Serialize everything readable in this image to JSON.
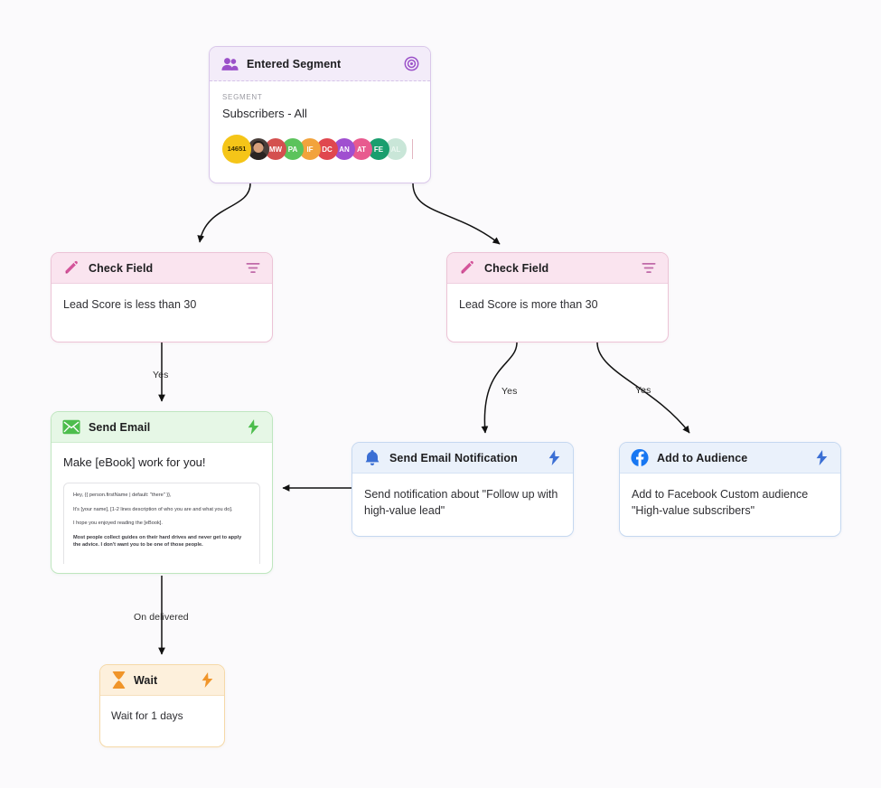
{
  "canvas": {
    "background": "#fbfafc"
  },
  "nodes": {
    "entered_segment": {
      "title": "Entered Segment",
      "icon": "people-group-icon",
      "right_icon": "target-icon",
      "segment_label": "SEGMENT",
      "segment_name": "Subscribers - All",
      "count": "14651",
      "accent": "#9b51c9",
      "avatars": [
        {
          "initials": "",
          "type": "photo",
          "color": "#4a3f3a"
        },
        {
          "initials": "MW",
          "type": "initials",
          "color": "#d4504f"
        },
        {
          "initials": "PA",
          "type": "initials",
          "color": "#5cc35c"
        },
        {
          "initials": "IF",
          "type": "initials",
          "color": "#f2a33c"
        },
        {
          "initials": "DC",
          "type": "initials",
          "color": "#e0474f"
        },
        {
          "initials": "AN",
          "type": "initials",
          "color": "#a04fd0"
        },
        {
          "initials": "AT",
          "type": "initials",
          "color": "#e85a8f"
        },
        {
          "initials": "FE",
          "type": "initials",
          "color": "#1a9e6e"
        },
        {
          "initials": "AL",
          "type": "initials",
          "color": "#c9e6d8"
        }
      ]
    },
    "check_field_left": {
      "title": "Check Field",
      "icon": "pencil-icon",
      "right_icon": "filter-icon",
      "body": "Lead Score is less than 30",
      "accent": "#d4549a"
    },
    "check_field_right": {
      "title": "Check Field",
      "icon": "pencil-icon",
      "right_icon": "filter-icon",
      "body": "Lead Score is more than 30",
      "accent": "#d4549a"
    },
    "send_email": {
      "title": "Send Email",
      "icon": "envelope-icon",
      "right_icon": "lightning-icon",
      "subject": "Make [eBook] work for you!",
      "accent": "#4dbd4d",
      "preview_lines": [
        {
          "text": "Hey, {{ person.firstName | default: \"there\" }},",
          "bold": false
        },
        {
          "text": "It's [your name], [1-2 lines description of who you are and what you do].",
          "bold": false
        },
        {
          "text": "I hope you enjoyed reading the [eBook].",
          "bold": false
        },
        {
          "text": "Most people collect guides on their hard drives and never get to apply the advice. I don't want you to be one of those people.",
          "bold": true
        }
      ]
    },
    "send_notification": {
      "title": "Send Email Notification",
      "icon": "bell-icon",
      "right_icon": "lightning-icon",
      "body": "Send notification about \"Follow up with high-value lead\"",
      "accent": "#3b6fd4"
    },
    "add_audience": {
      "title": "Add to Audience",
      "icon": "facebook-icon",
      "right_icon": "lightning-icon",
      "body": "Add to Facebook Custom audience \"High-value subscribers\"",
      "accent": "#1877f2"
    },
    "wait": {
      "title": "Wait",
      "icon": "hourglass-icon",
      "right_icon": "lightning-icon",
      "body": "Wait for 1 days",
      "accent": "#f0952a"
    }
  },
  "edges": [
    {
      "id": "seg-to-left",
      "label": ""
    },
    {
      "id": "seg-to-right",
      "label": ""
    },
    {
      "id": "left-check-to-email",
      "label": "Yes"
    },
    {
      "id": "right-check-to-notification",
      "label": "Yes"
    },
    {
      "id": "right-check-to-audience",
      "label": "Yes"
    },
    {
      "id": "email-to-wait",
      "label": "On delivered"
    },
    {
      "id": "notification-to-email",
      "label": ""
    }
  ],
  "edge_labels": {
    "yes_left": "Yes",
    "yes_mid": "Yes",
    "yes_right": "Yes",
    "on_delivered": "On delivered"
  }
}
